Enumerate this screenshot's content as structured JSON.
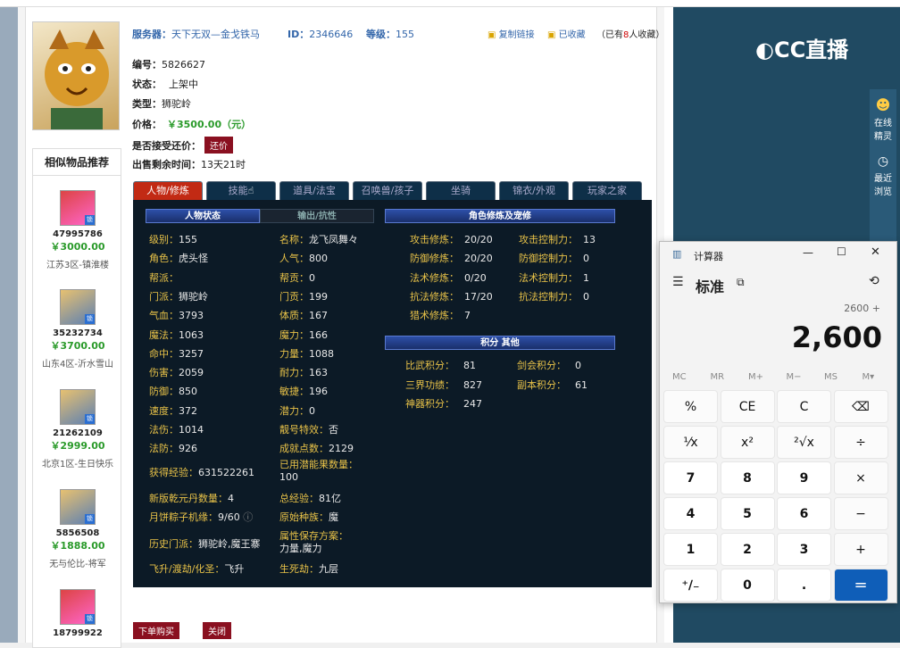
{
  "header": {
    "server_label": "服务器：",
    "server": "天下无双—金戈铁马",
    "id_label": "ID：",
    "id": "2346646",
    "level_label": "等级：",
    "level": "155",
    "copy_link": "复制链接",
    "fav": "已收藏",
    "fav_count_pre": "（已有",
    "fav_count": "8",
    "fav_count_post": "人收藏）"
  },
  "info": {
    "no_label": "编号：",
    "no": "5826627",
    "status_label": "状态：",
    "status": "上架中",
    "type_label": "类型：",
    "type": "狮驼岭",
    "price_label": "价格：",
    "price": "￥3500.00（元）",
    "bargain_label": "是否接受还价：",
    "bargain_btn": "还价",
    "time_label": "出售剩余时间：",
    "time": "13天21时"
  },
  "recommend": {
    "title": "相似物品推荐",
    "items": [
      {
        "id": "47995786",
        "price": "￥3000.00",
        "server": "江苏3区-镇淮楼"
      },
      {
        "id": "35232734",
        "price": "￥3700.00",
        "server": "山东4区-沂水雪山"
      },
      {
        "id": "21262109",
        "price": "￥2999.00",
        "server": "北京1区-生日快乐"
      },
      {
        "id": "5856508",
        "price": "￥1888.00",
        "server": "无与伦比-将军"
      },
      {
        "id": "18799922"
      }
    ]
  },
  "tabs": [
    "人物/修炼",
    "技能",
    "道具/法宝",
    "召唤兽/孩子",
    "坐骑",
    "锦衣/外观",
    "玩家之家"
  ],
  "panel": {
    "sec_status": "人物状态",
    "sec_output": "输出/抗性",
    "sec_cultivation": "角色修炼及宠修",
    "sec_points": "积分 其他",
    "col1": [
      [
        "级别：",
        "155"
      ],
      [
        "角色：",
        "虎头怪"
      ],
      [
        "帮派：",
        ""
      ],
      [
        "门派：",
        "狮驼岭"
      ],
      [
        "气血：",
        "3793"
      ],
      [
        "魔法：",
        "1063"
      ],
      [
        "命中：",
        "3257"
      ],
      [
        "伤害：",
        "2059"
      ],
      [
        "防御：",
        "850"
      ],
      [
        "速度：",
        "372"
      ],
      [
        "法伤：",
        "1014"
      ],
      [
        "法防：",
        "926"
      ]
    ],
    "col2": [
      [
        "名称：",
        "龙飞凤舞々"
      ],
      [
        "人气：",
        "800"
      ],
      [
        "帮贡：",
        "0"
      ],
      [
        "门贡：",
        "199"
      ],
      [
        "体质：",
        "167"
      ],
      [
        "魔力：",
        "166"
      ],
      [
        "力量：",
        "1088"
      ],
      [
        "耐力：",
        "163"
      ],
      [
        "敏捷：",
        "196"
      ],
      [
        "潜力：",
        "0"
      ],
      [
        "靓号特效：",
        "否"
      ],
      [
        "成就点数：",
        "2129"
      ]
    ],
    "exp_label": "获得经验：",
    "exp": "631522261",
    "used_label": "已用潜能果数量：",
    "used": "100",
    "newyuan_label": "新版乾元丹数量：",
    "newyuan": "4",
    "total_label": "总经验：",
    "total": "81亿",
    "cake_label": "月饼粽子机缘：",
    "cake": "9/60",
    "race_label": "原始种族：",
    "race": "魔",
    "history_label": "历史门派：",
    "history": "狮驼岭,魔王寨",
    "attr_label": "属性保存方案：",
    "attr": "力量,魔力",
    "fly_label": "飞升/渡劫/化圣：",
    "fly": "飞升",
    "life_label": "生死劫：",
    "life": "九层",
    "cult": [
      [
        "攻击修炼：",
        "20/20",
        "攻击控制力：",
        "13"
      ],
      [
        "防御修炼：",
        "20/20",
        "防御控制力：",
        "0"
      ],
      [
        "法术修炼：",
        "0/20",
        "法术控制力：",
        "1"
      ],
      [
        "抗法修炼：",
        "17/20",
        "抗法控制力：",
        "0"
      ],
      [
        "猎术修炼：",
        "7",
        "",
        ""
      ]
    ],
    "points": [
      [
        "比武积分：",
        "81",
        "剑会积分：",
        "0"
      ],
      [
        "三界功绩：",
        "827",
        "副本积分：",
        "61"
      ],
      [
        "神器积分：",
        "247",
        "",
        ""
      ]
    ]
  },
  "actions": {
    "buy": "下单购买",
    "close": "关闭"
  },
  "cc": {
    "logo": "CC直播",
    "side1": "在线精灵",
    "side2": "最近浏览"
  },
  "calc": {
    "title": "计算器",
    "mode": "标准",
    "expr": "2600 +",
    "display": "2,600",
    "mem": [
      "MC",
      "MR",
      "M+",
      "M−",
      "MS",
      "M▾"
    ],
    "keys": [
      "%",
      "CE",
      "C",
      "⌫",
      "⅟x",
      "x²",
      "²√x",
      "÷",
      "7",
      "8",
      "9",
      "×",
      "4",
      "5",
      "6",
      "−",
      "1",
      "2",
      "3",
      "+",
      "⁺∕₋",
      "0",
      ".",
      "="
    ]
  }
}
